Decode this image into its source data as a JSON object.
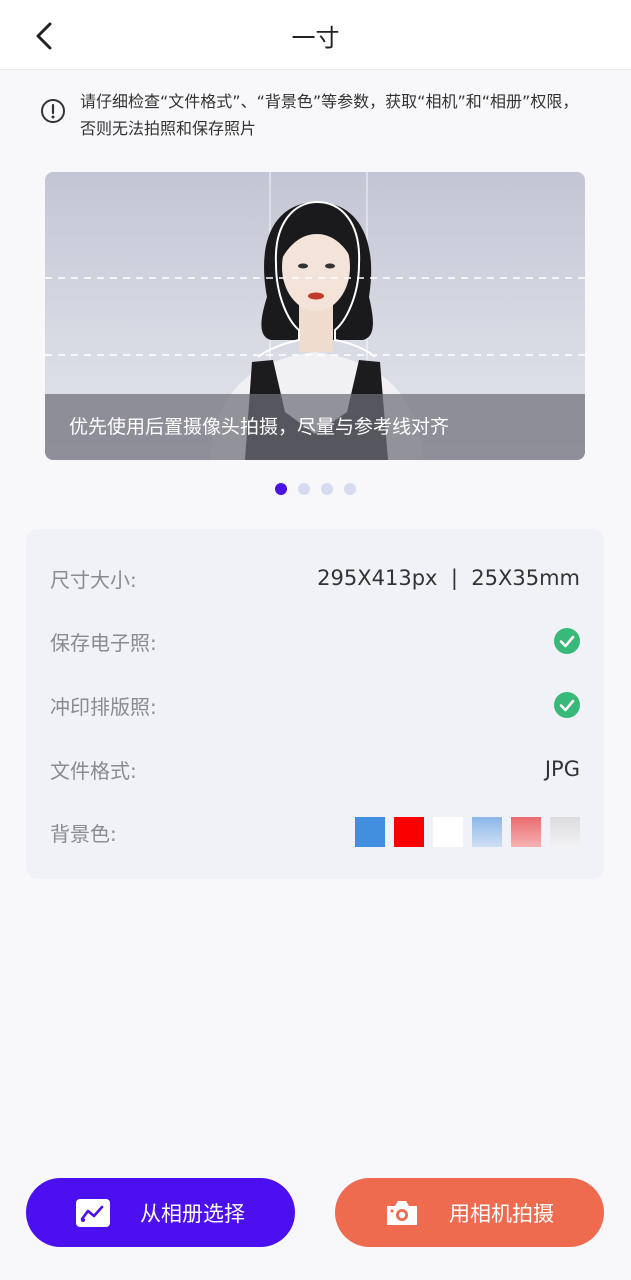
{
  "header": {
    "title": "一寸"
  },
  "notice": {
    "text": "请仔细检查“文件格式”、“背景色”等参数，获取“相机”和“相册”权限，否则无法拍照和保存照片"
  },
  "banner": {
    "caption": "优先使用后置摄像头拍摄，尽量与参考线对齐",
    "active_slide": 1,
    "slide_count": 4
  },
  "info": {
    "size": {
      "label": "尺寸大小:",
      "value": "295X413px  |  25X35mm"
    },
    "save_digital": {
      "label": "保存电子照:",
      "enabled": true
    },
    "print_layout": {
      "label": "冲印排版照:",
      "enabled": true
    },
    "format": {
      "label": "文件格式:",
      "value": "JPG"
    },
    "background": {
      "label": "背景色:",
      "colors": [
        "#438fdf",
        "#fb0000",
        "#ffffff",
        "#a8c8ec",
        "#ef7b80",
        "#e8e8eb"
      ]
    }
  },
  "buttons": {
    "album": {
      "label": "从相册选择",
      "color": "#4b0ff0"
    },
    "camera": {
      "label": "用相机拍摄",
      "color": "#ee6b4f"
    }
  },
  "colors": {
    "accent": "#4b12e6",
    "check": "#38b979"
  }
}
